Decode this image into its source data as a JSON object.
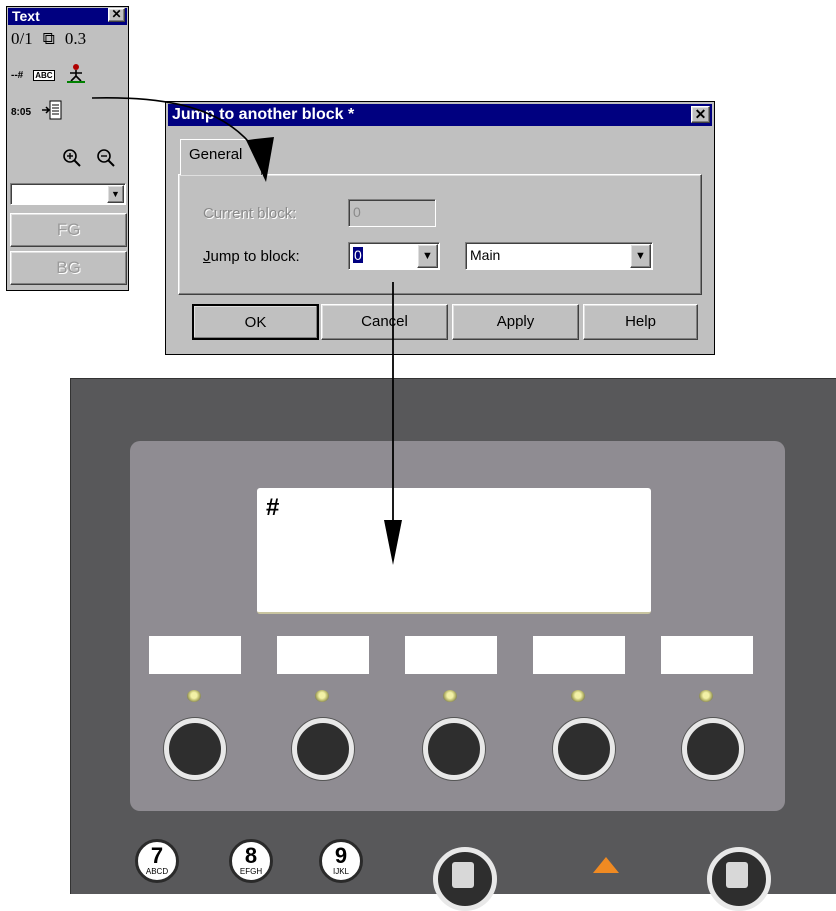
{
  "toolbox": {
    "title": "Text",
    "close": "✕",
    "tools": {
      "frac": "0/1",
      "copy": "⧉",
      "decimal": "0.3",
      "numfield": "--#",
      "abc": "ABC",
      "time": "8:05"
    },
    "combo_value": "",
    "fg_label": "FG",
    "bg_label": "BG"
  },
  "dialog": {
    "title": "Jump to another block *",
    "close": "✕",
    "tab": "General",
    "current_block_label": "Current block:",
    "current_block_value": "0",
    "jump_label": "Jump to block:",
    "jump_value": "0",
    "block_name": "Main",
    "buttons": {
      "ok": "OK",
      "cancel": "Cancel",
      "apply": "Apply",
      "help": "Help"
    }
  },
  "device": {
    "screen_text": "#",
    "numkeys": [
      {
        "digit": "7",
        "letters": "ABCD"
      },
      {
        "digit": "8",
        "letters": "EFGH"
      },
      {
        "digit": "9",
        "letters": "IJKL"
      }
    ]
  },
  "colors": {
    "titlebar": "#000080",
    "window_face": "#c0c0c0",
    "device_body": "#58585a",
    "faceplate": "#8f8c92",
    "accent_orange": "#f08a22"
  }
}
